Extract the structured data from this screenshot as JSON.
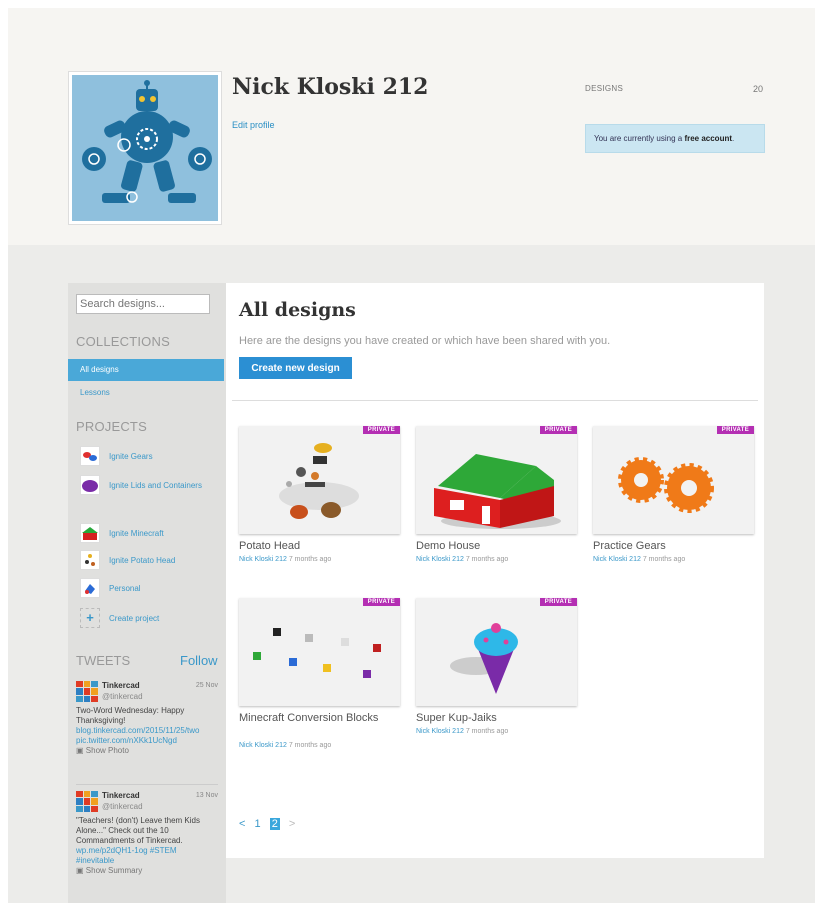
{
  "profile": {
    "username": "Nick Kloski 212",
    "edit_profile": "Edit profile",
    "designs_label": "DESIGNS",
    "designs_count": "20",
    "account_text": "You are currently using a",
    "account_type": "free account",
    "account_end": "."
  },
  "sidebar": {
    "search_placeholder": "Search designs...",
    "collections_title": "COLLECTIONS",
    "collections": [
      {
        "label": "All designs"
      },
      {
        "label": "Lessons"
      }
    ],
    "projects_title": "PROJECTS",
    "projects": [
      {
        "label": "Ignite Gears",
        "icon": "gears-thumbnail-icon"
      },
      {
        "label": "Ignite Lids and Containers",
        "icon": "lid-thumbnail-icon"
      },
      {
        "label": "Ignite Minecraft",
        "icon": "minecraft-thumbnail-icon"
      },
      {
        "label": "Ignite Potato Head",
        "icon": "potato-thumbnail-icon"
      },
      {
        "label": "Personal",
        "icon": "personal-thumbnail-icon"
      },
      {
        "label": "Create project",
        "icon": "plus-icon"
      }
    ],
    "tweets_title": "TWEETS",
    "follow_label": "Follow",
    "tweets": [
      {
        "name": "Tinkercad",
        "handle": "@tinkercad",
        "date": "25 Nov",
        "text": "Two-Word Wednesday: Happy Thanksgiving!",
        "link1": "blog.tinkercad.com/2015/11/25/two",
        "link2": "pic.twitter.com/nXKk1UcNgd",
        "show": "Show Photo"
      },
      {
        "name": "Tinkercad",
        "handle": "@tinkercad",
        "date": "13 Nov",
        "text": "\"Teachers! (don't) Leave them Kids Alone...\" Check out the 10 Commandments of Tinkercad.",
        "link1": "wp.me/p2dQH1-1og #STEM",
        "link2": "#inevitable",
        "show": "Show Summary"
      }
    ]
  },
  "main": {
    "title": "All designs",
    "subtitle": "Here are the designs you have created or which have been shared with you.",
    "create_label": "Create new design",
    "badge_label": "PRIVATE",
    "designs": [
      {
        "title": "Potato Head",
        "owner": "Nick Kloski 212",
        "age": "7 months ago"
      },
      {
        "title": "Demo House",
        "owner": "Nick Kloski 212",
        "age": "7 months ago"
      },
      {
        "title": "Practice Gears",
        "owner": "Nick Kloski 212",
        "age": "7 months ago"
      },
      {
        "title": "Minecraft Conversion Blocks",
        "owner": "Nick Kloski 212",
        "age": "7 months ago"
      },
      {
        "title": "Super Kup-Jaiks",
        "owner": "Nick Kloski 212",
        "age": "7 months ago"
      }
    ],
    "pagination": {
      "prev": "<",
      "page1": "1",
      "page2": "2",
      "next": ">"
    }
  },
  "colors": {
    "accent": "#2b8fd3",
    "link": "#3a98c9",
    "private_badge": "#b42fb3",
    "active_nav": "#4aa8d8"
  }
}
